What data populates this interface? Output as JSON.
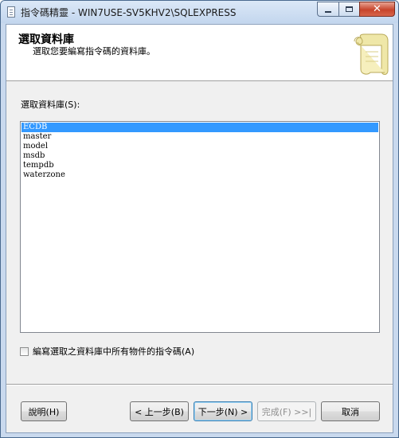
{
  "window": {
    "title": "指令碼精靈 - WIN7USE-SV5KHV2\\SQLEXPRESS",
    "minimize_glyph": "",
    "close_glyph": "✕"
  },
  "header": {
    "title": "選取資料庫",
    "subtitle": "選取您要編寫指令碼的資料庫。"
  },
  "database_list": {
    "label": "選取資料庫(S):",
    "items": [
      "ECDB",
      "master",
      "model",
      "msdb",
      "tempdb",
      "waterzone"
    ],
    "selected": "ECDB"
  },
  "script_all_objects": {
    "label": "編寫選取之資料庫中所有物件的指令碼(A)",
    "checked": false
  },
  "buttons": {
    "help": "說明(H)",
    "back": "< 上一步(B)",
    "next": "下一步(N) >",
    "finish": "完成(F) >>|",
    "cancel": "取消"
  },
  "colors": {
    "selection": "#3399ff",
    "dialog_bg": "#f0f0f0",
    "title_bar": "#c3d6ee",
    "close_button": "#c7442b"
  },
  "icons": {
    "title_icon": "document-icon",
    "header_icon": "scroll-icon"
  }
}
